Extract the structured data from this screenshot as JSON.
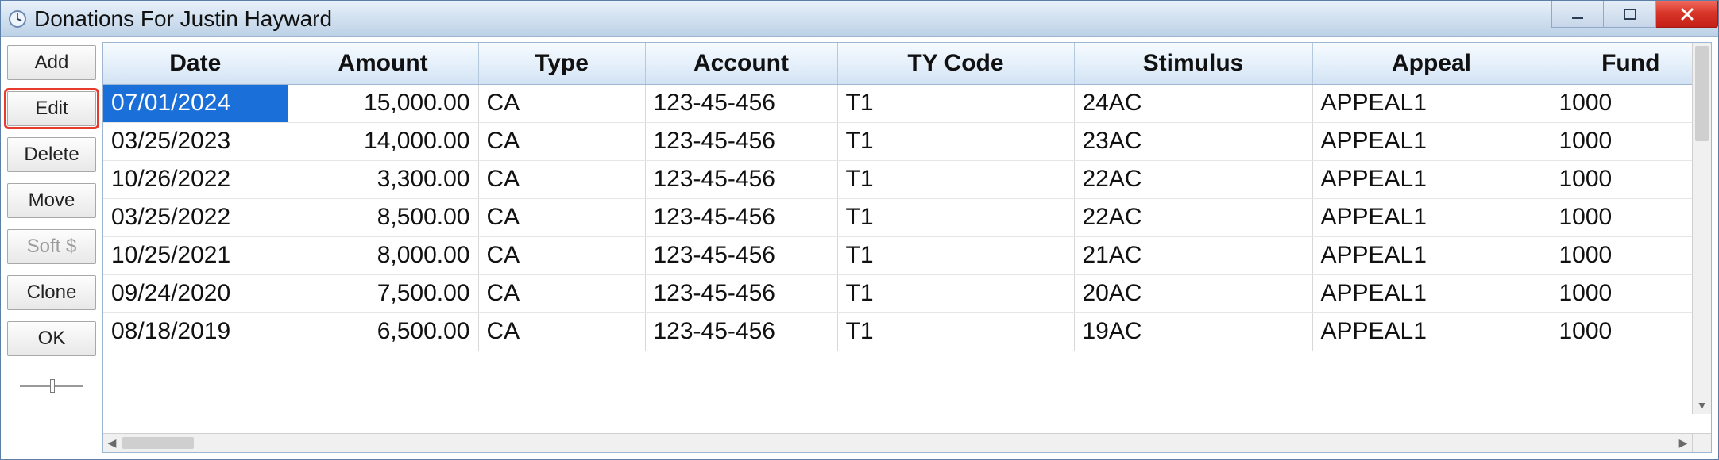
{
  "window": {
    "title": "Donations For Justin Hayward"
  },
  "sidebar": {
    "add": "Add",
    "edit": "Edit",
    "delete": "Delete",
    "move": "Move",
    "soft": "Soft $",
    "clone": "Clone",
    "ok": "OK"
  },
  "columns": {
    "date": "Date",
    "amount": "Amount",
    "type": "Type",
    "account": "Account",
    "tycode": "TY Code",
    "stimulus": "Stimulus",
    "appeal": "Appeal",
    "fund": "Fund"
  },
  "rows": [
    {
      "date": "07/01/2024",
      "amount": "15,000.00",
      "type": "CA",
      "account": "123-45-456",
      "tycode": "T1",
      "stimulus": "24AC",
      "appeal": "APPEAL1",
      "fund": "1000"
    },
    {
      "date": "03/25/2023",
      "amount": "14,000.00",
      "type": "CA",
      "account": "123-45-456",
      "tycode": "T1",
      "stimulus": "23AC",
      "appeal": "APPEAL1",
      "fund": "1000"
    },
    {
      "date": "10/26/2022",
      "amount": "3,300.00",
      "type": "CA",
      "account": "123-45-456",
      "tycode": "T1",
      "stimulus": "22AC",
      "appeal": "APPEAL1",
      "fund": "1000"
    },
    {
      "date": "03/25/2022",
      "amount": "8,500.00",
      "type": "CA",
      "account": "123-45-456",
      "tycode": "T1",
      "stimulus": "22AC",
      "appeal": "APPEAL1",
      "fund": "1000"
    },
    {
      "date": "10/25/2021",
      "amount": "8,000.00",
      "type": "CA",
      "account": "123-45-456",
      "tycode": "T1",
      "stimulus": "21AC",
      "appeal": "APPEAL1",
      "fund": "1000"
    },
    {
      "date": "09/24/2020",
      "amount": "7,500.00",
      "type": "CA",
      "account": "123-45-456",
      "tycode": "T1",
      "stimulus": "20AC",
      "appeal": "APPEAL1",
      "fund": "1000"
    },
    {
      "date": "08/18/2019",
      "amount": "6,500.00",
      "type": "CA",
      "account": "123-45-456",
      "tycode": "T1",
      "stimulus": "19AC",
      "appeal": "APPEAL1",
      "fund": "1000"
    }
  ],
  "selected_row_index": 0,
  "highlighted_button": "edit"
}
